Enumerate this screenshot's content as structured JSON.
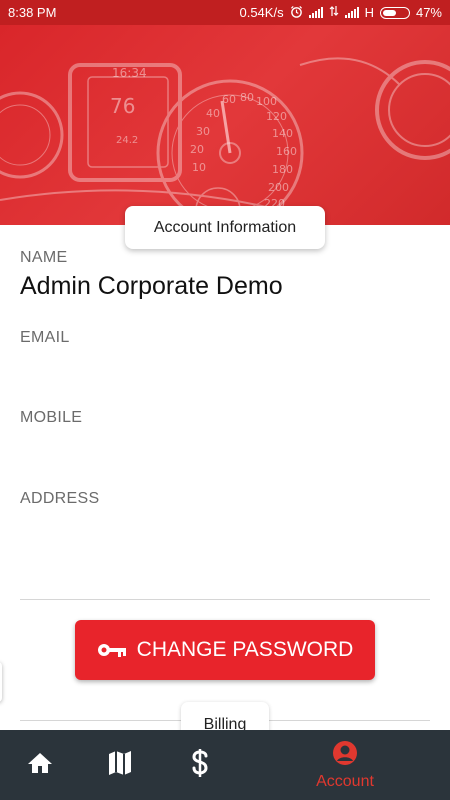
{
  "status_bar": {
    "time": "8:38 PM",
    "speed": "0.54K/s",
    "network": "H",
    "battery": "47%"
  },
  "section": {
    "title": "Account Information"
  },
  "fields": {
    "name_label": "NAME",
    "name_value": "Admin Corporate Demo",
    "email_label": "EMAIL",
    "email_value": "",
    "mobile_label": "MOBILE",
    "mobile_value": "",
    "address_label": "ADDRESS",
    "address_value": ""
  },
  "actions": {
    "change_password_label": "CHANGE PASSWORD"
  },
  "billing": {
    "title": "Billing"
  },
  "bottom_nav": {
    "items": [
      {
        "icon": "home-icon",
        "label": ""
      },
      {
        "icon": "map-icon",
        "label": ""
      },
      {
        "icon": "dollar-icon",
        "label": ""
      },
      {
        "icon": "account-icon",
        "label": "Account"
      }
    ],
    "active": "Account",
    "active_color": "#e0382f"
  },
  "colors": {
    "brand_red": "#e8242b",
    "header_red": "#c01f20",
    "nav_bg": "#2b343b"
  }
}
